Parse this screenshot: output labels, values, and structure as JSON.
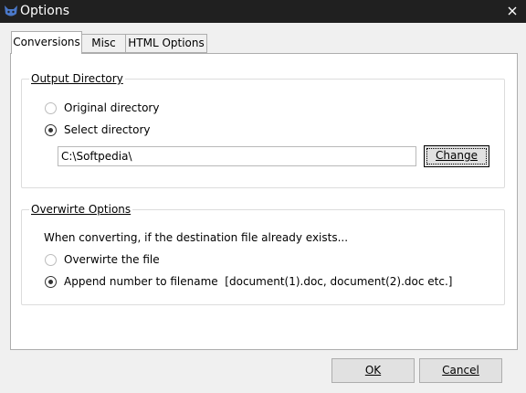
{
  "window": {
    "title": "Options"
  },
  "tabs": [
    {
      "label": "Conversions",
      "active": true
    },
    {
      "label": "Misc",
      "active": false
    },
    {
      "label": "HTML Options",
      "active": false
    }
  ],
  "output_directory": {
    "label": "Output Directory",
    "options": [
      {
        "label": "Original directory",
        "checked": false
      },
      {
        "label": "Select directory",
        "checked": true
      }
    ],
    "path_value": "C:\\Softpedia\\",
    "change_label": "Change"
  },
  "overwrite_options": {
    "label": "Overwirte Options",
    "description": "When converting, if the destination file already exists...",
    "options": [
      {
        "label": "Overwirte the file",
        "checked": false
      },
      {
        "label": "Append number to filename  [document(1).doc, document(2).doc etc.]",
        "checked": true
      }
    ]
  },
  "footer": {
    "ok_label": "OK",
    "cancel_label": "Cancel"
  },
  "icons": {
    "app": "cat-head-icon",
    "close": "close-icon"
  },
  "colors": {
    "titlebar": "#202020",
    "accent_icon": "#4a78c8"
  }
}
